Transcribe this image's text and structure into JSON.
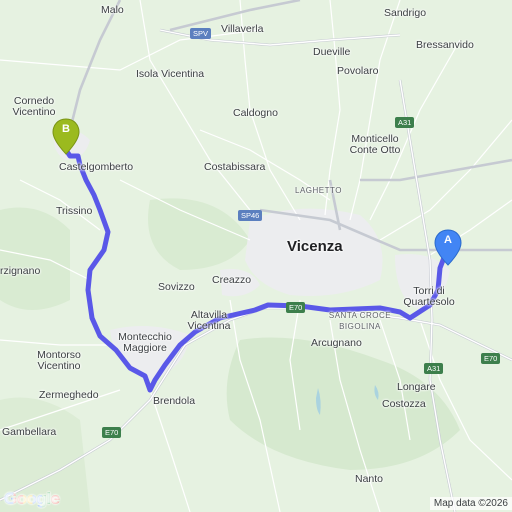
{
  "labels": {
    "malo": "Malo",
    "sandrigo": "Sandrigo",
    "villaverla": "Villaverla",
    "dueville": "Dueville",
    "bressanvido": "Bressanvido",
    "povolaro": "Povolaro",
    "isola_vicentina": "Isola Vicentina",
    "cornedo_vicentino": "Cornedo Vicentino",
    "caldogno": "Caldogno",
    "monticello_conte_otto": "Monticello Conte Otto",
    "castelgomberto": "Castelgomberto",
    "costabissara": "Costabissara",
    "laghetto": "LAGHETTO",
    "trissino": "Trissino",
    "vicenza": "Vicenza",
    "arzignano": "rzignano",
    "sovizzo": "Sovizzo",
    "creazzo": "Creazzo",
    "torri_di_quartesolo": "Torri di Quartesolo",
    "altavilla_vicentina": "Altavilla Vicentina",
    "santa_croce_bigolina": "SANTA CROCE BIGOLINA",
    "montecchio_maggiore": "Montecchio Maggiore",
    "arcugnano": "Arcugnano",
    "montorso_vicentino": "Montorso Vicentino",
    "zermeghedo": "Zermeghedo",
    "longare": "Longare",
    "brendola": "Brendola",
    "costozza": "Costozza",
    "gambellara": "Gambellara",
    "nanto": "Nanto"
  },
  "road_shields": {
    "spv": "SPV",
    "a31_north": "A31",
    "sp46": "SP46",
    "e70_center": "E70",
    "e70_east": "E70",
    "a31_south": "A31",
    "e70_southwest": "E70"
  },
  "markers": {
    "start": {
      "letter": "A",
      "color": "#4285f4"
    },
    "end": {
      "letter": "B",
      "color": "#9bba1e"
    }
  },
  "footer": {
    "logo": "Google",
    "attribution": "Map data ©2026"
  },
  "colors": {
    "route": "#5a58e8",
    "land": "#e8f3e4",
    "urban": "#ecedef",
    "road": "#ffffff",
    "water": "#aad3df"
  }
}
